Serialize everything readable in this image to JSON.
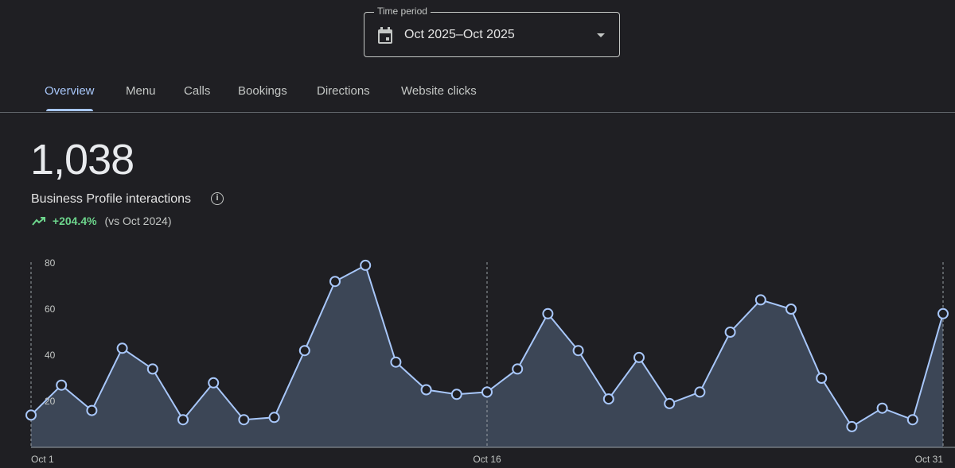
{
  "time_period": {
    "label": "Time period",
    "value": "Oct 2025–Oct 2025",
    "icon": "calendar-icon"
  },
  "tabs": [
    {
      "label": "Overview",
      "active": true
    },
    {
      "label": "Menu"
    },
    {
      "label": "Calls"
    },
    {
      "label": "Bookings"
    },
    {
      "label": "Directions"
    },
    {
      "label": "Website clicks"
    }
  ],
  "summary": {
    "total": "1,038",
    "metric": "Business Profile interactions",
    "change": "+204.4%",
    "comparison": "(vs Oct 2024)",
    "trend_icon": "trending-up-icon"
  },
  "colors": {
    "accent": "#a8c7fa",
    "positive": "#6dd58c",
    "area_fill": "#3c4656"
  },
  "chart_data": {
    "type": "area",
    "x_tick_labels": [
      "Oct 1",
      "Oct 16",
      "Oct 31"
    ],
    "y_tick_labels": [
      "20",
      "40",
      "60",
      "80"
    ],
    "ylim": [
      0,
      80
    ],
    "x": [
      "Oct 1",
      "Oct 2",
      "Oct 3",
      "Oct 4",
      "Oct 5",
      "Oct 6",
      "Oct 7",
      "Oct 8",
      "Oct 9",
      "Oct 10",
      "Oct 11",
      "Oct 12",
      "Oct 13",
      "Oct 14",
      "Oct 15",
      "Oct 16",
      "Oct 17",
      "Oct 18",
      "Oct 19",
      "Oct 20",
      "Oct 21",
      "Oct 22",
      "Oct 23",
      "Oct 24",
      "Oct 25",
      "Oct 26",
      "Oct 27",
      "Oct 28",
      "Oct 29",
      "Oct 30",
      "Oct 31"
    ],
    "values": [
      14,
      27,
      16,
      43,
      34,
      12,
      28,
      12,
      13,
      42,
      72,
      79,
      37,
      25,
      23,
      24,
      34,
      58,
      42,
      21,
      39,
      19,
      24,
      50,
      64,
      60,
      30,
      9,
      17,
      12,
      58
    ],
    "grid": false
  }
}
